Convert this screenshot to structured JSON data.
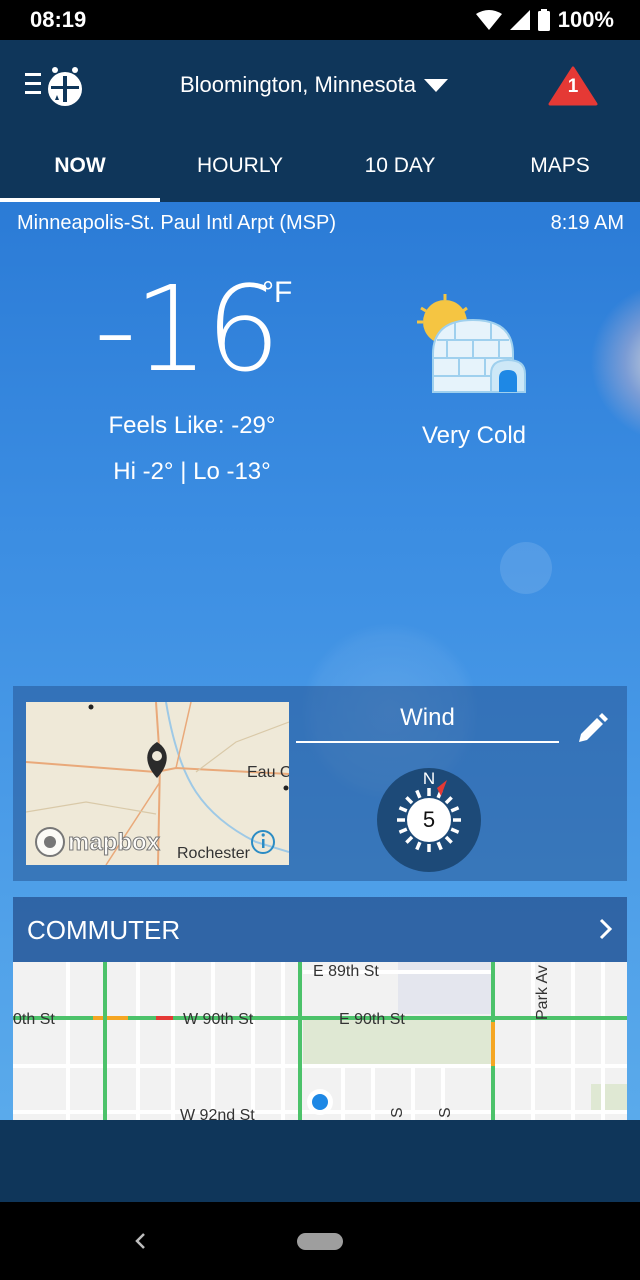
{
  "status_bar": {
    "time": "08:19",
    "battery": "100%"
  },
  "header": {
    "location": "Bloomington, Minnesota",
    "alert_count": "1",
    "icons": {
      "menu": "menu-logo-icon",
      "dropdown": "caret-down-icon",
      "alert": "warning-triangle-icon"
    },
    "alert_color": "#e53935"
  },
  "tabs": [
    {
      "label": "NOW",
      "active": true
    },
    {
      "label": "HOURLY",
      "active": false
    },
    {
      "label": "10 DAY",
      "active": false
    },
    {
      "label": "MAPS",
      "active": false
    }
  ],
  "current": {
    "station": "Minneapolis-St. Paul Intl Arpt (MSP)",
    "observation_time": "8:19 AM",
    "temperature": "-16",
    "unit": "°F",
    "feels_like": "Feels Like: -29°",
    "hi_lo": "Hi -2° | Lo -13°",
    "condition": "Very Cold",
    "condition_icon": "igloo-sun-icon"
  },
  "map_card": {
    "map_labels": {
      "eau": "Eau C",
      "rochester": "Rochester",
      "attribution": "mapbox"
    },
    "wind_title": "Wind",
    "wind_speed": "5",
    "compass_north": "N",
    "edit_icon": "pencil-icon"
  },
  "commuter": {
    "title": "COMMUTER",
    "streets": {
      "e89": "E 89th St",
      "w90_left": "0th St",
      "w90": "W 90th St",
      "e90": "E 90th St",
      "w92": "W 92nd St",
      "park": "Park Av",
      "s1": "S",
      "s2": "S"
    }
  },
  "colors": {
    "header": "#0f365a",
    "sky_top": "#2b7bd6",
    "sky_bottom": "#5aaaeb"
  }
}
